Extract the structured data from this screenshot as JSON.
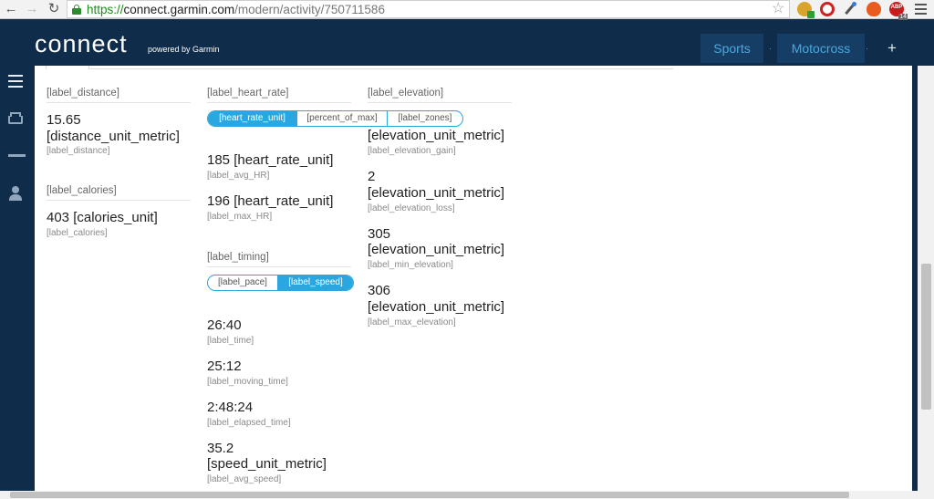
{
  "browser": {
    "url_scheme": "https://",
    "url_host": "connect.garmin.com",
    "url_path": "/modern/activity/750711586",
    "abp_label": "ABP",
    "abp_count": "14"
  },
  "header": {
    "logo": "connect",
    "powered_by": "powered by Garmin",
    "tabs": [
      {
        "label": "Sports"
      },
      {
        "label": "Motocross"
      }
    ],
    "tab_separator": "·",
    "add_label": "+"
  },
  "sidebar": {
    "icons": [
      "menu-icon",
      "inbox-icon",
      "shoes-icon",
      "user-icon"
    ]
  },
  "distance": {
    "heading": "[label_distance]",
    "value": "15.65 [distance_unit_metric]",
    "sublabel": "[label_distance]"
  },
  "calories": {
    "heading": "[label_calories]",
    "value": "403 [calories_unit]",
    "sublabel": "[label_calories]"
  },
  "heart_rate": {
    "heading": "[label_heart_rate]",
    "toggle": [
      {
        "label": "[heart_rate_unit]",
        "active": true
      },
      {
        "label": "[percent_of_max]",
        "active": false
      },
      {
        "label": "[label_zones]",
        "active": false
      }
    ],
    "avg_value": "185 [heart_rate_unit]",
    "avg_label": "[label_avg_HR]",
    "max_value": "196 [heart_rate_unit]",
    "max_label": "[label_max_HR]"
  },
  "timing": {
    "heading": "[label_timing]",
    "toggle": [
      {
        "label": "[label_pace]",
        "active": false
      },
      {
        "label": "[label_speed]",
        "active": true
      }
    ],
    "time_value": "26:40",
    "time_label": "[label_time]",
    "moving_value": "25:12",
    "moving_label": "[label_moving_time]",
    "elapsed_value": "2:48:24",
    "elapsed_label": "[label_elapsed_time]",
    "speed_value": "35.2",
    "speed_unit": "[speed_unit_metric]",
    "speed_label": "[label_avg_speed]"
  },
  "elevation": {
    "heading": "[label_elevation]",
    "gain_unit": "[elevation_unit_metric]",
    "gain_label": "[label_elevation_gain]",
    "loss_value": "2",
    "loss_unit": "[elevation_unit_metric]",
    "loss_label": "[label_elevation_loss]",
    "min_value": "305",
    "min_unit": "[elevation_unit_metric]",
    "min_label": "[label_min_elevation]",
    "max_value": "306",
    "max_unit": "[elevation_unit_metric]",
    "max_label": "[label_max_elevation]"
  },
  "colors": {
    "brand_dark": "#0f2d4b",
    "accent": "#2aa7e0"
  }
}
